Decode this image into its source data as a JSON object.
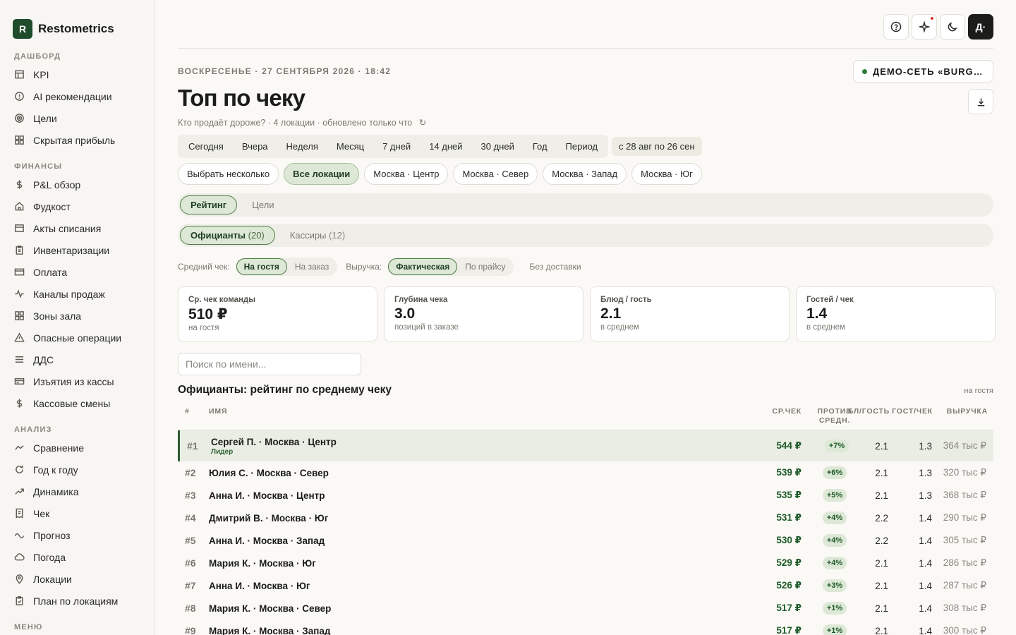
{
  "brand": {
    "logo": "R",
    "name": "Restometrics"
  },
  "sidebar": {
    "sections": [
      {
        "title": "ДАШБОРД",
        "items": [
          {
            "label": "KPI",
            "icon": "table-icon"
          },
          {
            "label": "AI рекомендации",
            "icon": "alert-circle-icon"
          },
          {
            "label": "Цели",
            "icon": "target-icon"
          },
          {
            "label": "Скрытая прибыль",
            "icon": "grid-icon"
          }
        ]
      },
      {
        "title": "ФИНАНСЫ",
        "items": [
          {
            "label": "P&L обзор",
            "icon": "dollar-icon"
          },
          {
            "label": "Фудкост",
            "icon": "home-icon"
          },
          {
            "label": "Акты списания",
            "icon": "list-icon"
          },
          {
            "label": "Инвентаризации",
            "icon": "clipboard-icon"
          },
          {
            "label": "Оплата",
            "icon": "card-icon"
          },
          {
            "label": "Каналы продаж",
            "icon": "pulse-icon"
          },
          {
            "label": "Зоны зала",
            "icon": "grid-icon"
          },
          {
            "label": "Опасные операции",
            "icon": "warning-icon"
          },
          {
            "label": "ДДС",
            "icon": "menu-icon"
          },
          {
            "label": "Изъятия из кассы",
            "icon": "cashbox-icon"
          },
          {
            "label": "Кассовые смены",
            "icon": "dollar-icon"
          }
        ]
      },
      {
        "title": "АНАЛИЗ",
        "items": [
          {
            "label": "Сравнение",
            "icon": "chevron-up-icon"
          },
          {
            "label": "Год к году",
            "icon": "refresh-icon"
          },
          {
            "label": "Динамика",
            "icon": "trend-up-icon"
          },
          {
            "label": "Чек",
            "icon": "receipt-icon"
          },
          {
            "label": "Прогноз",
            "icon": "wave-icon"
          },
          {
            "label": "Погода",
            "icon": "cloud-icon"
          },
          {
            "label": "Локации",
            "icon": "pin-icon"
          },
          {
            "label": "План по локациям",
            "icon": "clipboard-check-icon"
          }
        ]
      },
      {
        "title": "МЕНЮ",
        "items": []
      }
    ]
  },
  "topbar": {
    "avatar": "Д·"
  },
  "header": {
    "date": "ВОСКРЕСЕНЬЕ · 27 СЕНТЯБРЯ 2026 · 18:42",
    "title": "Топ по чеку",
    "subtitle": "Кто продаёт дороже? · 4 локации · обновлено только что",
    "refresh": "↻",
    "network": "ДЕМО-СЕТЬ «BURGER»"
  },
  "periods": [
    "Сегодня",
    "Вчера",
    "Неделя",
    "Месяц",
    "7 дней",
    "14 дней",
    "30 дней",
    "Год",
    "Период"
  ],
  "range": "с 28 авг по 26 сен",
  "locations": {
    "multi": "Выбрать несколько",
    "items": [
      "Все локации",
      "Москва · Центр",
      "Москва · Север",
      "Москва · Запад",
      "Москва · Юг"
    ],
    "active": "Все локации"
  },
  "view_tabs": {
    "rating": "Рейтинг",
    "goals": "Цели"
  },
  "staff_tabs": {
    "waiters": "Официанты",
    "waiters_count": "(20)",
    "cashiers": "Кассиры",
    "cashiers_count": "(12)"
  },
  "filters": {
    "check_label": "Средний чек:",
    "per_guest": "На гостя",
    "per_order": "На заказ",
    "revenue_label": "Выручка:",
    "actual": "Фактическая",
    "by_price": "По прайсу",
    "no_delivery": "Без доставки"
  },
  "kpis": [
    {
      "label": "Ср. чек команды",
      "value": "510 ₽",
      "sub": "на гостя"
    },
    {
      "label": "Глубина чека",
      "value": "3.0",
      "sub": "позиций в заказе"
    },
    {
      "label": "Блюд / гость",
      "value": "2.1",
      "sub": "в среднем"
    },
    {
      "label": "Гостей / чек",
      "value": "1.4",
      "sub": "в среднем"
    }
  ],
  "search": {
    "placeholder": "Поиск по имени..."
  },
  "table": {
    "title": "Официанты: рейтинг по среднему чеку",
    "note": "на гостя",
    "columns": {
      "rank": "#",
      "name": "ИМЯ",
      "check": "СР.ЧЕК",
      "delta_1": "ПРОТИВ",
      "delta_2": "СРЕДН.",
      "dish": "БЛ/ГОСТЬ",
      "guest": "ГОСТ/ЧЕК",
      "revenue": "ВЫРУЧКА"
    },
    "leader_tag": "Лидер",
    "rows": [
      {
        "rank": "#1",
        "name": "Сергей П. · Москва · Центр",
        "check": "544 ₽",
        "delta": "+7%",
        "dish": "2.1",
        "guest": "1.3",
        "revenue": "364 тыс ₽"
      },
      {
        "rank": "#2",
        "name": "Юлия С. · Москва · Север",
        "check": "539 ₽",
        "delta": "+6%",
        "dish": "2.1",
        "guest": "1.3",
        "revenue": "320 тыс ₽"
      },
      {
        "rank": "#3",
        "name": "Анна И. · Москва · Центр",
        "check": "535 ₽",
        "delta": "+5%",
        "dish": "2.1",
        "guest": "1.3",
        "revenue": "368 тыс ₽"
      },
      {
        "rank": "#4",
        "name": "Дмитрий В. · Москва · Юг",
        "check": "531 ₽",
        "delta": "+4%",
        "dish": "2.2",
        "guest": "1.4",
        "revenue": "290 тыс ₽"
      },
      {
        "rank": "#5",
        "name": "Анна И. · Москва · Запад",
        "check": "530 ₽",
        "delta": "+4%",
        "dish": "2.2",
        "guest": "1.4",
        "revenue": "305 тыс ₽"
      },
      {
        "rank": "#6",
        "name": "Мария К. · Москва · Юг",
        "check": "529 ₽",
        "delta": "+4%",
        "dish": "2.1",
        "guest": "1.4",
        "revenue": "286 тыс ₽"
      },
      {
        "rank": "#7",
        "name": "Анна И. · Москва · Юг",
        "check": "526 ₽",
        "delta": "+3%",
        "dish": "2.1",
        "guest": "1.4",
        "revenue": "287 тыс ₽"
      },
      {
        "rank": "#8",
        "name": "Мария К. · Москва · Север",
        "check": "517 ₽",
        "delta": "+1%",
        "dish": "2.1",
        "guest": "1.4",
        "revenue": "308 тыс ₽"
      },
      {
        "rank": "#9",
        "name": "Мария К. · Москва · Запад",
        "check": "517 ₽",
        "delta": "+1%",
        "dish": "2.1",
        "guest": "1.4",
        "revenue": "300 тыс ₽"
      }
    ]
  }
}
